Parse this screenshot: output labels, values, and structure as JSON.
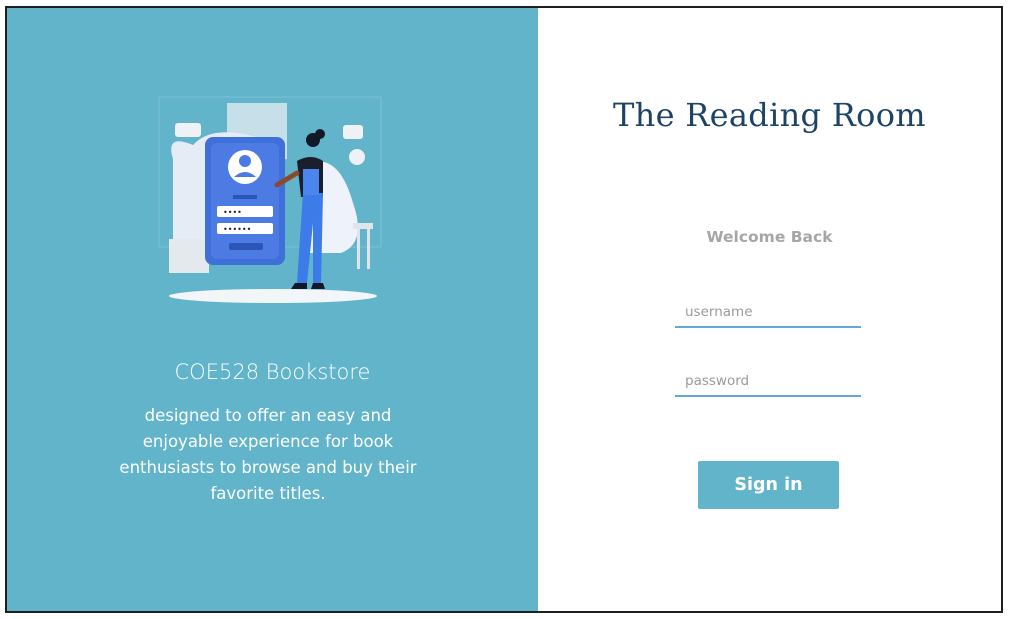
{
  "brand": {
    "title": "COE528 Bookstore",
    "description": "designed to offer an easy and enjoyable experience for book enthusiasts to browse and buy their favorite titles."
  },
  "login": {
    "app_title": "The Reading Room",
    "welcome": "Welcome Back",
    "username_placeholder": "username",
    "password_placeholder": "password",
    "signin_label": "Sign in"
  },
  "illustration": {
    "username_dots": "••••",
    "password_dots": "••••••"
  },
  "colors": {
    "panel": "#62b4cb",
    "title": "#1d4466",
    "input_underline": "#62a8d8",
    "button": "#62b4cb",
    "welcome": "#a6a6a6"
  }
}
